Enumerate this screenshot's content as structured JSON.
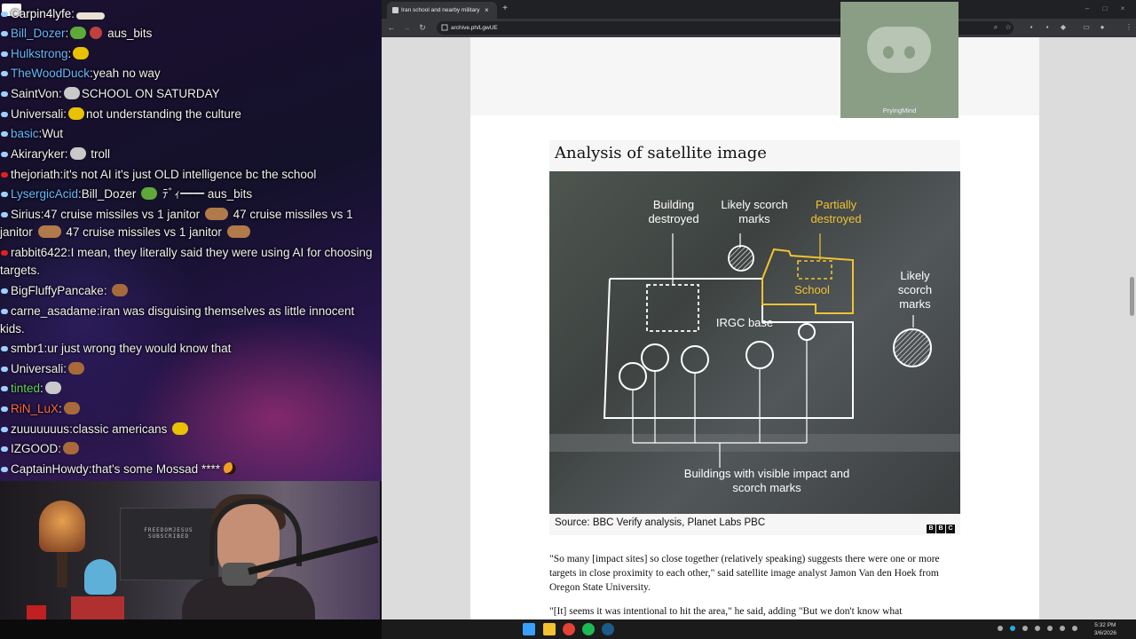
{
  "chat": {
    "messages": [
      {
        "user": "Carpin4lyfe",
        "user_color": "#ffffff",
        "text": ""
      },
      {
        "user": "Bill_Dozer",
        "user_color": "#66b8ff",
        "text": "aus_bits"
      },
      {
        "user": "Hulkstrong",
        "user_color": "#66b8ff",
        "text": ""
      },
      {
        "user": "TheWoodDuck",
        "user_color": "#66b8ff",
        "text": "yeah no way"
      },
      {
        "user": "SaintVon",
        "user_color": "#ffffff",
        "text": "SCHOOL ON SATURDAY"
      },
      {
        "user": "Universali",
        "user_color": "#ffffff",
        "text": "not understanding the culture"
      },
      {
        "user": "basic",
        "user_color": "#66b8ff",
        "text": "Wut"
      },
      {
        "user": "Akiraryker",
        "user_color": "#ffffff",
        "text": "troll"
      },
      {
        "user": "thejoriath",
        "user_color": "#ffffff",
        "text": "it's not AI it's just OLD intelligence bc the school"
      },
      {
        "user": "LysergicAcid",
        "user_color": "#66b8ff",
        "text": "Bill_Dozer",
        "text2": "ﾃﾞｨ━━ aus_bits"
      },
      {
        "user": "Sirius",
        "user_color": "#ffffff",
        "text": "47 cruise missiles vs 1 janitor",
        "text2": "47 cruise missiles vs 1 janitor",
        "text3": "47 cruise missiles vs 1 janitor"
      },
      {
        "user": "rabbit6422",
        "user_color": "#ffffff",
        "text": "I mean, they literally said they were using AI for choosing targets."
      },
      {
        "user": "BigFluffyPancake",
        "user_color": "#ffffff",
        "text": ""
      },
      {
        "user": "carne_asadame",
        "user_color": "#ffffff",
        "text": "iran was disguising themselves as little innocent kids."
      },
      {
        "user": "smbr1",
        "user_color": "#ffffff",
        "text": "ur just wrong they would know that"
      },
      {
        "user": "Universali",
        "user_color": "#ffffff",
        "text": ""
      },
      {
        "user": "tinted",
        "user_color": "#5fd35f",
        "text": ""
      },
      {
        "user": "RiN_LuX",
        "user_color": "#ff6a3d",
        "text": ""
      },
      {
        "user": "zuuuuuuus",
        "user_color": "#ffffff",
        "text": "classic americans"
      },
      {
        "user": "IZGOOD",
        "user_color": "#ffffff",
        "text": ""
      },
      {
        "user": "CaptainHowdy",
        "user_color": "#ffffff",
        "text": "that's some Mossad ****"
      }
    ]
  },
  "webcam": {
    "shelf_text": "FREEDOMJESUS SUBSCRIBED"
  },
  "browser": {
    "tab_title": "Iran school and nearby military",
    "tab_close": "×",
    "new_tab": "+",
    "url": "archive.ph/LgwUE",
    "window_controls": [
      "–",
      "□",
      "×"
    ]
  },
  "overlay": {
    "discord_name": "PryingMind"
  },
  "article": {
    "figure_title": "Analysis of satellite image",
    "labels": {
      "building_destroyed": "Building destroyed",
      "likely_scorch_1": "Likely scorch marks",
      "partially_destroyed": "Partially destroyed",
      "school": "School",
      "likely_scorch_2": "Likely scorch marks",
      "irgc_base": "IRGC base",
      "buildings_visible": "Buildings with visible impact and scorch marks"
    },
    "source": "Source: BBC Verify analysis, Planet Labs PBC",
    "bbc_letters": [
      "B",
      "B",
      "C"
    ],
    "paragraph1": "\"So many [impact sites] so close together (relatively speaking) suggests there were one or more targets in close proximity to each other,\" said satellite image analyst Jamon Van den Hoek from Oregon State University.",
    "paragraph2": "\"[It] seems it was intentional to hit the area,\" he said, adding \"But we don't know what"
  },
  "taskbar": {
    "time": "5:32 PM",
    "date": "3/6/2026"
  }
}
